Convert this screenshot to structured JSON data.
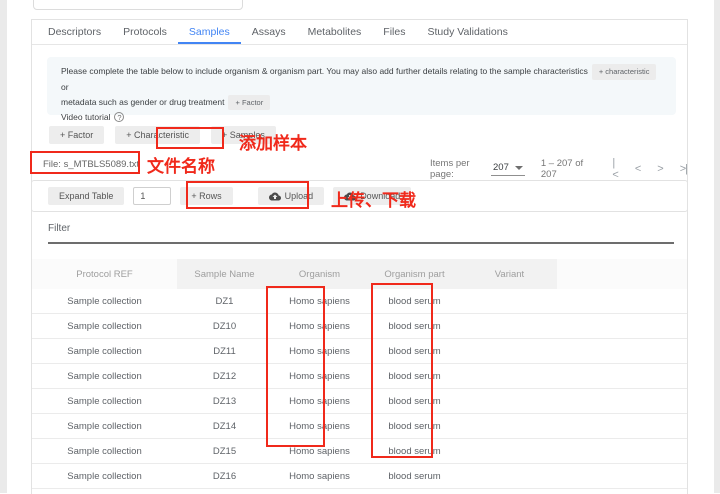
{
  "tabs": {
    "items": [
      {
        "label": "Descriptors",
        "active": false
      },
      {
        "label": "Protocols",
        "active": false
      },
      {
        "label": "Samples",
        "active": true
      },
      {
        "label": "Assays",
        "active": false
      },
      {
        "label": "Metabolites",
        "active": false
      },
      {
        "label": "Files",
        "active": false
      },
      {
        "label": "Study Validations",
        "active": false
      }
    ]
  },
  "notice": {
    "line1": "Please complete the table below to include organism & organism part. You may also add further details relating to the sample characteristics",
    "chip_characteristic": "+ characteristic",
    "or_text": "or",
    "line2": "metadata such as gender or drug treatment",
    "chip_factor": "+ Factor",
    "video_tutorial": "Video tutorial",
    "help_glyph": "?"
  },
  "actions": {
    "factor": "+ Factor",
    "characteristic": "+ Characteristic",
    "samples": "+ Samples"
  },
  "file": {
    "label": "File: s_MTBLS5089.txt"
  },
  "paginator": {
    "items_per_page_label": "Items per page:",
    "items_per_page_value": "207",
    "range": "1 – 207 of 207",
    "nav": {
      "first": "|<",
      "prev": "<",
      "next": ">",
      "last": ">|"
    }
  },
  "table_controls": {
    "expand": "Expand Table",
    "rows_value": "1",
    "add_rows": "+ Rows",
    "upload": "Upload",
    "download": "Download"
  },
  "filter": {
    "label": "Filter"
  },
  "table": {
    "headers": [
      "Protocol REF",
      "Sample Name",
      "Organism",
      "Organism part",
      "Variant"
    ],
    "rows": [
      {
        "protocol": "Sample collection",
        "sample": "DZ1",
        "organism": "Homo sapiens",
        "part": "blood serum",
        "variant": ""
      },
      {
        "protocol": "Sample collection",
        "sample": "DZ10",
        "organism": "Homo sapiens",
        "part": "blood serum",
        "variant": ""
      },
      {
        "protocol": "Sample collection",
        "sample": "DZ11",
        "organism": "Homo sapiens",
        "part": "blood serum",
        "variant": ""
      },
      {
        "protocol": "Sample collection",
        "sample": "DZ12",
        "organism": "Homo sapiens",
        "part": "blood serum",
        "variant": ""
      },
      {
        "protocol": "Sample collection",
        "sample": "DZ13",
        "organism": "Homo sapiens",
        "part": "blood serum",
        "variant": ""
      },
      {
        "protocol": "Sample collection",
        "sample": "DZ14",
        "organism": "Homo sapiens",
        "part": "blood serum",
        "variant": ""
      },
      {
        "protocol": "Sample collection",
        "sample": "DZ15",
        "organism": "Homo sapiens",
        "part": "blood serum",
        "variant": ""
      },
      {
        "protocol": "Sample collection",
        "sample": "DZ16",
        "organism": "Homo sapiens",
        "part": "blood serum",
        "variant": ""
      }
    ]
  },
  "annotations": {
    "add_samples": "添加样本",
    "file_name": "文件名称",
    "upload_download": "上传、下载",
    "color": "#f0291b"
  },
  "colors": {
    "accent": "#4285f4",
    "annotation_red": "#f0291b"
  }
}
